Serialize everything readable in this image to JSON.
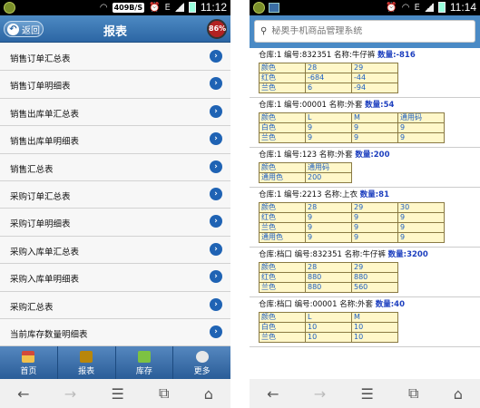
{
  "left": {
    "status": {
      "net_speed": "409B/S",
      "net_type": "E",
      "time": "11:12"
    },
    "header": {
      "back_label": "返回",
      "title": "报表",
      "badge": "86%"
    },
    "menu": [
      "销售订单汇总表",
      "销售订单明细表",
      "销售出库单汇总表",
      "销售出库单明细表",
      "销售汇总表",
      "采购订单汇总表",
      "采购订单明细表",
      "采购入库单汇总表",
      "采购入库单明细表",
      "采购汇总表",
      "当前库存数量明细表"
    ],
    "tabs": [
      {
        "label": "首页",
        "icon": "home-icon"
      },
      {
        "label": "报表",
        "icon": "report-icon"
      },
      {
        "label": "库存",
        "icon": "stock-icon"
      },
      {
        "label": "更多",
        "icon": "more-icon"
      }
    ]
  },
  "right": {
    "status": {
      "net_type": "E",
      "time": "11:14"
    },
    "search": {
      "placeholder": "秘奥手机商品管理系统"
    },
    "records": [
      {
        "warehouse": "仓库:1",
        "code": "编号:832351",
        "name": "名称:牛仔裤",
        "qty": "数量:-816",
        "rows": [
          [
            "颜色",
            "28",
            "29"
          ],
          [
            "红色",
            "-684",
            "-44"
          ],
          [
            "兰色",
            "6",
            "-94"
          ]
        ]
      },
      {
        "warehouse": "仓库:1",
        "code": "编号:00001",
        "name": "名称:外套",
        "qty": "数量:54",
        "rows": [
          [
            "颜色",
            "L",
            "M",
            "通用码"
          ],
          [
            "白色",
            "9",
            "9",
            "9"
          ],
          [
            "兰色",
            "9",
            "9",
            "9"
          ]
        ]
      },
      {
        "warehouse": "仓库:1",
        "code": "编号:123",
        "name": "名称:外套",
        "qty": "数量:200",
        "rows": [
          [
            "颜色",
            "通用码"
          ],
          [
            "通用色",
            "200"
          ]
        ]
      },
      {
        "warehouse": "仓库:1",
        "code": "编号:2213",
        "name": "名称:上衣",
        "qty": "数量:81",
        "rows": [
          [
            "颜色",
            "28",
            "29",
            "30"
          ],
          [
            "红色",
            "9",
            "9",
            "9"
          ],
          [
            "兰色",
            "9",
            "9",
            "9"
          ],
          [
            "通用色",
            "9",
            "9",
            "9"
          ]
        ]
      },
      {
        "warehouse": "仓库:档口",
        "code": "编号:832351",
        "name": "名称:牛仔裤",
        "qty": "数量:3200",
        "rows": [
          [
            "颜色",
            "28",
            "29"
          ],
          [
            "红色",
            "880",
            "880"
          ],
          [
            "兰色",
            "880",
            "560"
          ]
        ]
      },
      {
        "warehouse": "仓库:档口",
        "code": "编号:00001",
        "name": "名称:外套",
        "qty": "数量:40",
        "rows": [
          [
            "颜色",
            "L",
            "M"
          ],
          [
            "白色",
            "10",
            "10"
          ],
          [
            "兰色",
            "10",
            "10"
          ]
        ]
      }
    ]
  },
  "nav": {
    "back": "←",
    "forward": "→",
    "menu": "☰",
    "tabs": "⧉",
    "home": "⌂"
  }
}
